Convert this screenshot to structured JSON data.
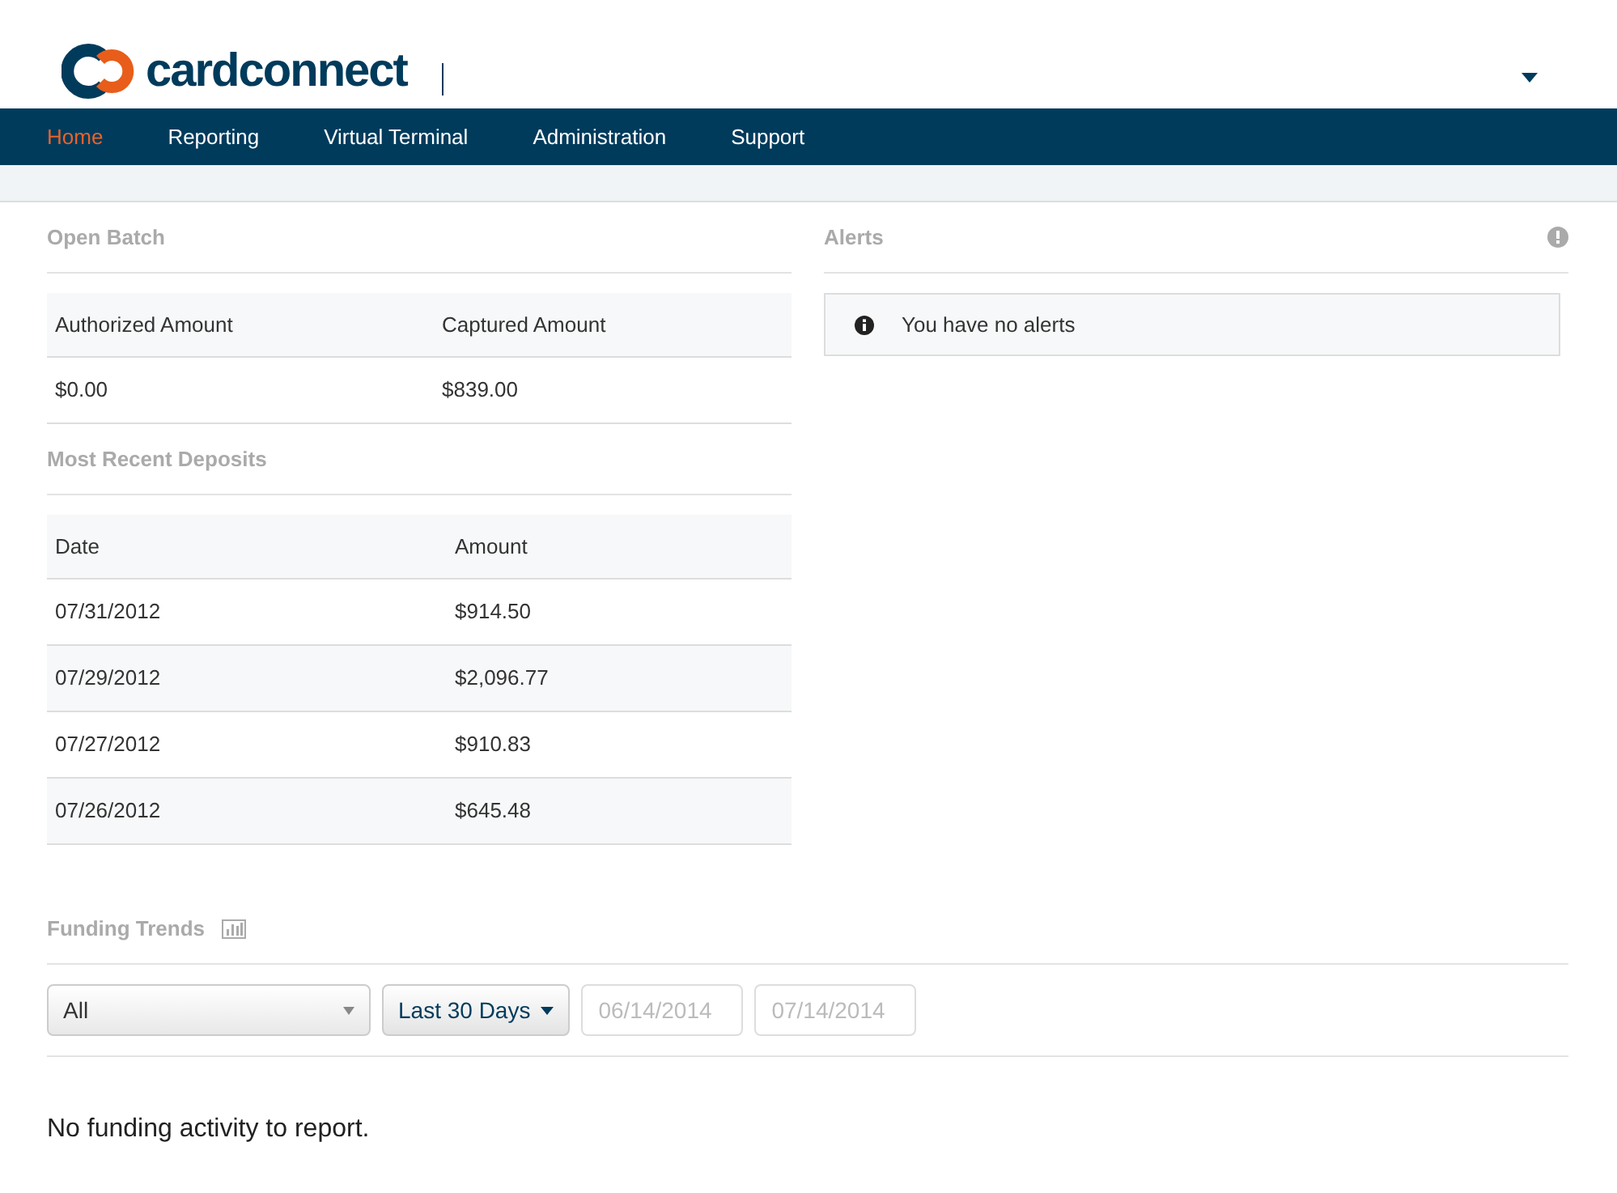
{
  "logo": {
    "text": "cardconnect"
  },
  "nav": [
    {
      "label": "Home",
      "selected": true
    },
    {
      "label": "Reporting",
      "selected": false
    },
    {
      "label": "Virtual Terminal",
      "selected": false
    },
    {
      "label": "Administration",
      "selected": false
    },
    {
      "label": "Support",
      "selected": false
    }
  ],
  "open_batch": {
    "title": "Open Batch",
    "columns": [
      "Authorized Amount",
      "Captured Amount"
    ],
    "rows": [
      [
        "$0.00",
        "$839.00"
      ]
    ]
  },
  "deposits": {
    "title": "Most Recent Deposits",
    "columns": [
      "Date",
      "Amount"
    ],
    "rows": [
      [
        "07/31/2012",
        "$914.50"
      ],
      [
        "07/29/2012",
        "$2,096.77"
      ],
      [
        "07/27/2012",
        "$910.83"
      ],
      [
        "07/26/2012",
        "$645.48"
      ]
    ]
  },
  "alerts": {
    "title": "Alerts",
    "message": "You have no alerts"
  },
  "funding_trends": {
    "title": "Funding Trends",
    "filter": {
      "value": "All"
    },
    "range": {
      "label": "Last 30 Days"
    },
    "start_date": {
      "placeholder": "06/14/2014"
    },
    "end_date": {
      "placeholder": "07/14/2014"
    },
    "empty_message": "No funding activity to report."
  }
}
